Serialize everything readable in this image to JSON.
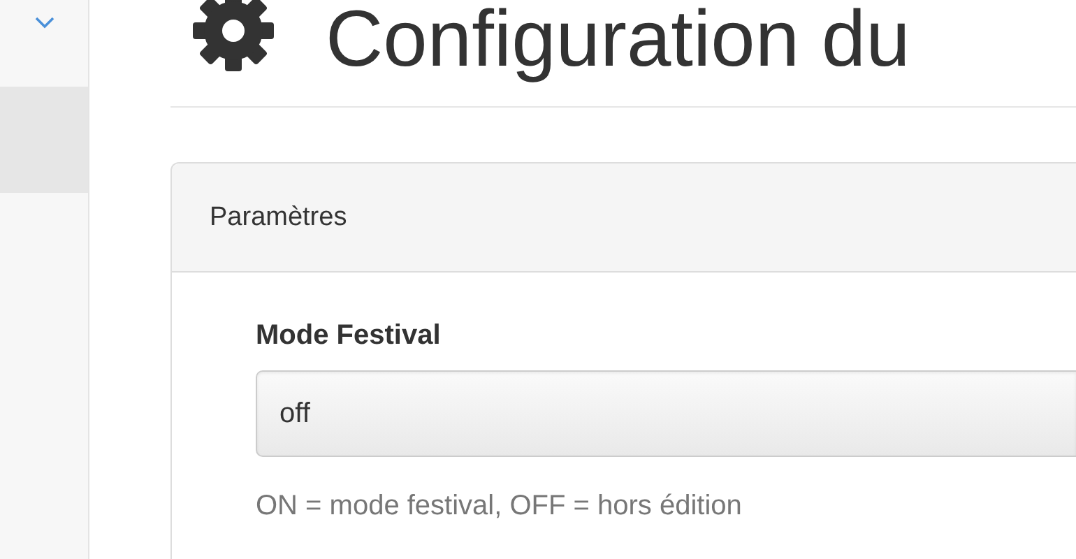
{
  "sidebar": {
    "expanded": true,
    "items": [
      {
        "selected": true
      }
    ]
  },
  "page": {
    "title": "Configuration du"
  },
  "panel": {
    "heading": "Paramètres",
    "fields": [
      {
        "kind": "select",
        "label": "Mode Festival",
        "value": "off",
        "help": "ON = mode festival, OFF = hors édition"
      }
    ]
  }
}
